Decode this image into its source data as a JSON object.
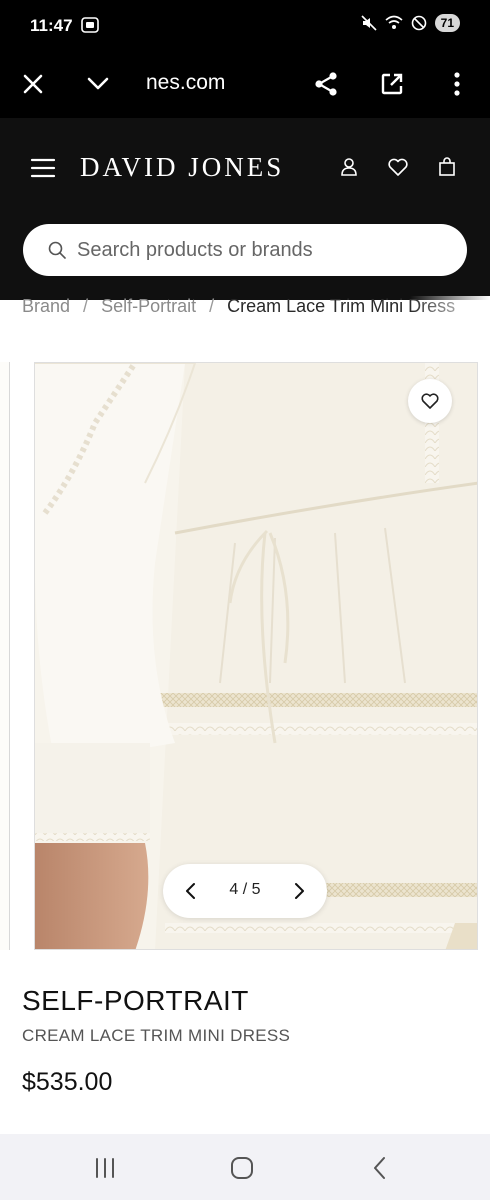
{
  "status_bar": {
    "time": "11:47",
    "battery": "71"
  },
  "browser": {
    "url": "nes.com"
  },
  "header": {
    "logo": "DAVID JONES"
  },
  "search": {
    "placeholder": "Search products or brands"
  },
  "breadcrumb": {
    "items": [
      "Brand",
      "Self-Portrait",
      "Cream Lace Trim Mini Dress"
    ],
    "separator": "/"
  },
  "gallery": {
    "counter": "4 / 5",
    "current": 4,
    "total": 5
  },
  "product": {
    "brand": "SELF-PORTRAIT",
    "name": "CREAM LACE TRIM MINI DRESS",
    "price": "$535.00"
  },
  "colors": {
    "header_bg": "#101010",
    "image_bg": "#f7f4ec",
    "nav_bg": "#f2f2f6"
  }
}
